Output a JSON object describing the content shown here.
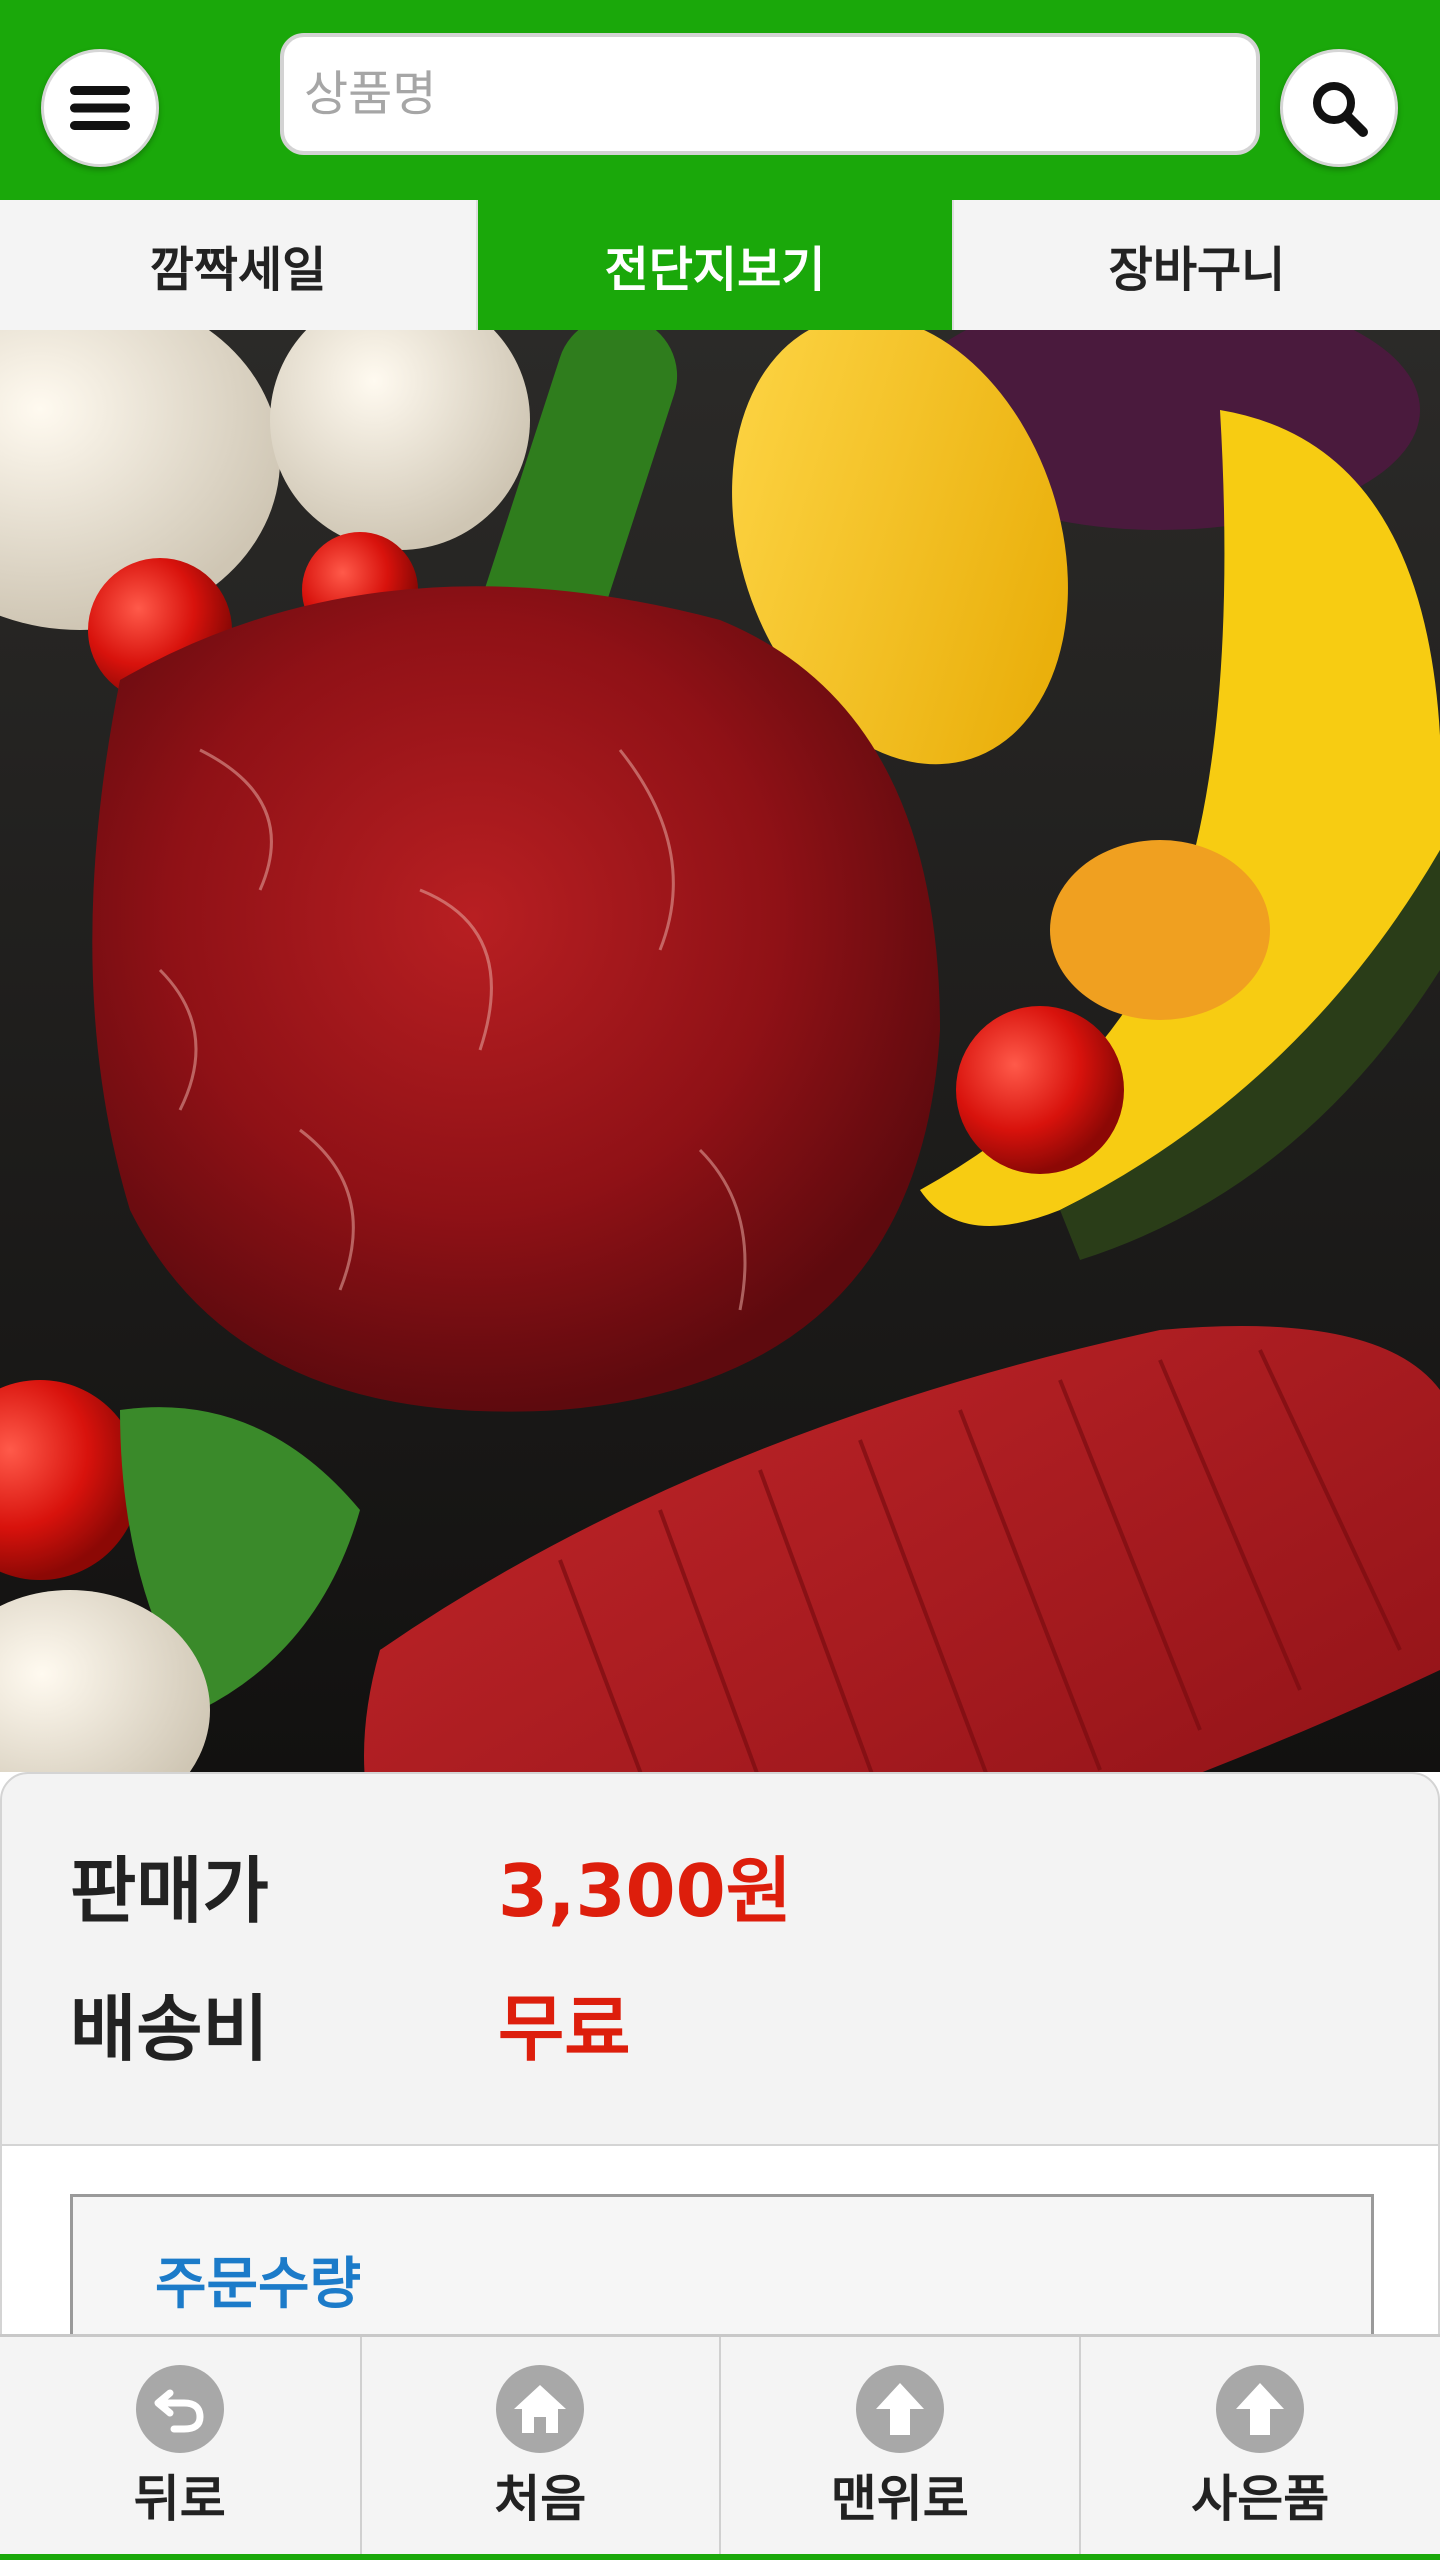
{
  "header": {
    "search_placeholder": "상품명",
    "menu_icon": "menu-icon",
    "search_icon": "search-icon",
    "brand_color": "#1aa80a"
  },
  "tabs": [
    {
      "label": "깜짝세일",
      "active": false
    },
    {
      "label": "전단지보기",
      "active": true
    },
    {
      "label": "장바구니",
      "active": false
    }
  ],
  "product": {
    "image": "beef-and-vegetables-photo",
    "price_label": "판매가",
    "price_value": "3,300원",
    "shipping_label": "배송비",
    "shipping_value": "무료",
    "price_color": "#dd1e0c"
  },
  "order": {
    "quantity_label": "주문수량"
  },
  "bottom_nav": [
    {
      "label": "뒤로",
      "icon": "back-arrow-icon"
    },
    {
      "label": "처음",
      "icon": "home-icon"
    },
    {
      "label": "맨위로",
      "icon": "arrow-up-icon"
    },
    {
      "label": "사은품",
      "icon": "arrow-up-icon"
    }
  ]
}
